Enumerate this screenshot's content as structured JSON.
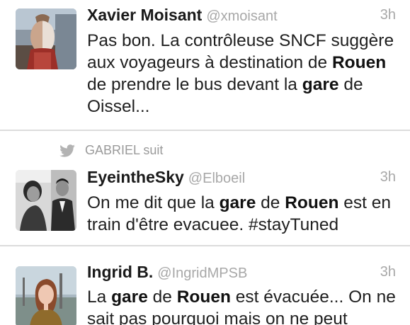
{
  "tweets": [
    {
      "name": "Xavier Moisant",
      "handle": "@xmoisant",
      "time": "3h",
      "avatar_icon": "profile-photo",
      "text_parts": [
        "Pas bon. La contrôleuse SNCF suggère aux voyageurs à destination de ",
        "Rouen",
        " de prendre le bus devant la ",
        "gare",
        " de Oissel..."
      ]
    },
    {
      "context_icon": "twitter-bird-icon",
      "context_text": "GABRIEL suit",
      "name": "EyeintheSky",
      "handle": "@Elboeil",
      "time": "3h",
      "avatar_icon": "profile-photo",
      "text_parts": [
        "On me dit que la ",
        "gare",
        " de ",
        "Rouen",
        " est en train d'être evacuee. #stayTuned"
      ]
    },
    {
      "name": "Ingrid B.",
      "handle": "@IngridMPSB",
      "time": "3h",
      "avatar_icon": "profile-photo",
      "text_parts": [
        "La ",
        "gare",
        " de ",
        "Rouen",
        " est évacuée... On ne sait pas pourquoi mais on ne peut"
      ]
    }
  ],
  "colors": {
    "name": "#1a1a1a",
    "meta": "#a8a8a8",
    "separator": "#dcdcdc",
    "bird": "#b3b3b3"
  }
}
